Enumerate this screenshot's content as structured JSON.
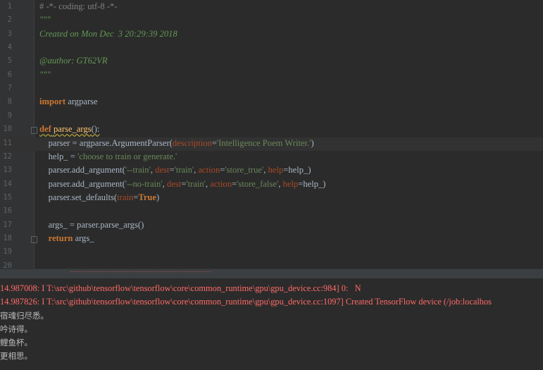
{
  "editor": {
    "lines": [
      {
        "num": "1",
        "tokens": [
          {
            "t": "# -*- coding: utf-8 -*-",
            "c": "c-gray"
          }
        ]
      },
      {
        "num": "2",
        "tokens": [
          {
            "t": "\"\"\"",
            "c": "c-doc"
          }
        ]
      },
      {
        "num": "3",
        "tokens": [
          {
            "t": "Created on Mon Dec  3 20:29:39 2018",
            "c": "c-doc"
          }
        ]
      },
      {
        "num": "4",
        "tokens": []
      },
      {
        "num": "5",
        "tokens": [
          {
            "t": "@author: GT62VR",
            "c": "c-doc"
          }
        ]
      },
      {
        "num": "6",
        "tokens": [
          {
            "t": "\"\"\"",
            "c": "c-doc"
          }
        ]
      },
      {
        "num": "7",
        "tokens": []
      },
      {
        "num": "8",
        "tokens": [
          {
            "t": "import",
            "c": "c-kw"
          },
          {
            "t": " argparse",
            "c": "c-plain"
          }
        ]
      },
      {
        "num": "9",
        "tokens": []
      },
      {
        "num": "10",
        "tokens": [
          {
            "t": "def",
            "c": "c-kw c-und"
          },
          {
            "t": " ",
            "c": "c-plain c-und"
          },
          {
            "t": "parse_args",
            "c": "c-fn c-und"
          },
          {
            "t": "():",
            "c": "c-plain c-und"
          }
        ]
      },
      {
        "num": "11",
        "tokens": [
          {
            "t": "    parser = argparse.ArgumentParser(",
            "c": "c-plain"
          },
          {
            "t": "description",
            "c": "c-param"
          },
          {
            "t": "=",
            "c": "c-plain"
          },
          {
            "t": "'Intelligence Poem Writer.'",
            "c": "c-str"
          },
          {
            "t": ")",
            "c": "c-plain"
          }
        ]
      },
      {
        "num": "12",
        "tokens": [
          {
            "t": "    help_ = ",
            "c": "c-plain"
          },
          {
            "t": "'choose to train or generate.'",
            "c": "c-str"
          }
        ]
      },
      {
        "num": "13",
        "tokens": [
          {
            "t": "    parser.add_argument(",
            "c": "c-plain"
          },
          {
            "t": "'--train'",
            "c": "c-str"
          },
          {
            "t": ", ",
            "c": "c-plain"
          },
          {
            "t": "dest",
            "c": "c-param"
          },
          {
            "t": "=",
            "c": "c-plain"
          },
          {
            "t": "'train'",
            "c": "c-str"
          },
          {
            "t": ", ",
            "c": "c-plain"
          },
          {
            "t": "action",
            "c": "c-param"
          },
          {
            "t": "=",
            "c": "c-plain"
          },
          {
            "t": "'store_true'",
            "c": "c-str"
          },
          {
            "t": ", ",
            "c": "c-plain"
          },
          {
            "t": "help",
            "c": "c-param"
          },
          {
            "t": "=help_)",
            "c": "c-plain"
          }
        ]
      },
      {
        "num": "14",
        "tokens": [
          {
            "t": "    parser.add_argument(",
            "c": "c-plain"
          },
          {
            "t": "'--no-train'",
            "c": "c-str"
          },
          {
            "t": ", ",
            "c": "c-plain"
          },
          {
            "t": "dest",
            "c": "c-param"
          },
          {
            "t": "=",
            "c": "c-plain"
          },
          {
            "t": "'train'",
            "c": "c-str"
          },
          {
            "t": ", ",
            "c": "c-plain"
          },
          {
            "t": "action",
            "c": "c-param"
          },
          {
            "t": "=",
            "c": "c-plain"
          },
          {
            "t": "'store_false'",
            "c": "c-str"
          },
          {
            "t": ", ",
            "c": "c-plain"
          },
          {
            "t": "help",
            "c": "c-param"
          },
          {
            "t": "=help_)",
            "c": "c-plain"
          }
        ]
      },
      {
        "num": "15",
        "tokens": [
          {
            "t": "    parser.set_defaults(",
            "c": "c-plain"
          },
          {
            "t": "train",
            "c": "c-param"
          },
          {
            "t": "=",
            "c": "c-plain"
          },
          {
            "t": "True",
            "c": "c-true"
          },
          {
            "t": ")",
            "c": "c-plain"
          }
        ]
      },
      {
        "num": "16",
        "tokens": []
      },
      {
        "num": "17",
        "tokens": [
          {
            "t": "    args_ = parser.parse_args()",
            "c": "c-plain"
          }
        ]
      },
      {
        "num": "18",
        "tokens": [
          {
            "t": "    ",
            "c": "c-plain"
          },
          {
            "t": "return",
            "c": "c-kw"
          },
          {
            "t": " args_",
            "c": "c-plain"
          }
        ]
      },
      {
        "num": "19",
        "tokens": []
      },
      {
        "num": "20",
        "tokens": []
      }
    ],
    "current_line": "11",
    "fold_markers": [
      "10",
      "18"
    ]
  },
  "console": {
    "lines": [
      {
        "text": "14.987008: I T:\\src\\github\\tensorflow\\tensorflow\\core\\common_runtime\\gpu\\gpu_device.cc:984] 0:   N",
        "kind": "err"
      },
      {
        "text": "14.987826: I T:\\src\\github\\tensorflow\\tensorflow\\core\\common_runtime\\gpu\\gpu_device.cc:1097] Created TensorFlow device (/job:localhos",
        "kind": "err"
      },
      {
        "text": "宿魂归尽悉。",
        "kind": "out"
      },
      {
        "text": "吟诗得。",
        "kind": "out"
      },
      {
        "text": "鲤鱼杯。",
        "kind": "out"
      },
      {
        "text": "更相思。",
        "kind": "out"
      }
    ]
  }
}
